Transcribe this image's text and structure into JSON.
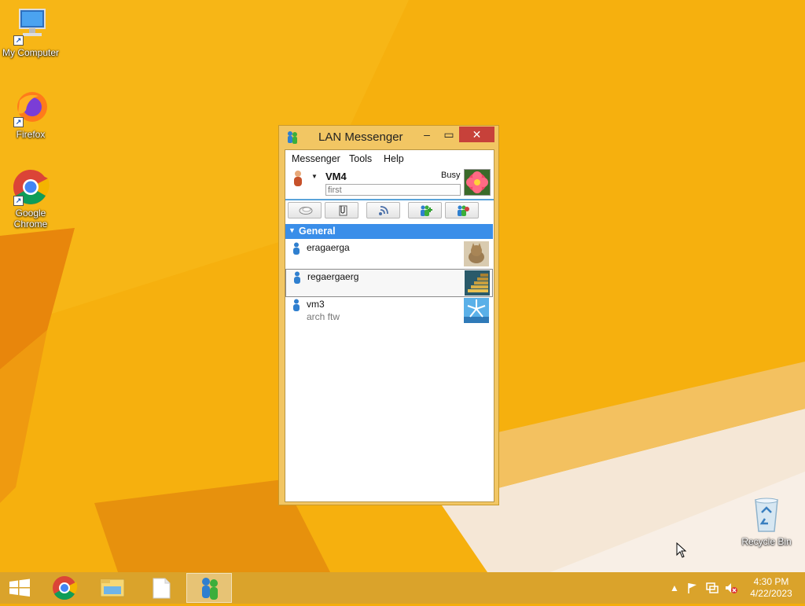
{
  "desktop": {
    "icons": [
      {
        "label": "My Computer",
        "icon": "computer-icon"
      },
      {
        "label": "Firefox",
        "icon": "firefox-icon"
      },
      {
        "label": "Google Chrome",
        "icon": "chrome-icon"
      },
      {
        "label": "Recycle Bin",
        "icon": "recycle-bin-icon"
      }
    ]
  },
  "window": {
    "title": "LAN Messenger",
    "controls": {
      "minimize": "‒",
      "maximize": "▭",
      "close": "✕"
    },
    "menu": [
      "Messenger",
      "Tools",
      "Help"
    ],
    "profile": {
      "name": "VM4",
      "status": "Busy",
      "note": "first",
      "status_icon": "busy-person-icon",
      "avatar": "flower-avatar"
    },
    "toolbar": [
      "chat-icon",
      "file-transfer-icon",
      "broadcast-icon",
      "add-contacts-icon",
      "settings-icon"
    ],
    "group": {
      "name": "General",
      "expanded": true
    },
    "contacts": [
      {
        "name": "eragaerga",
        "note": "",
        "avatar": "cat-avatar",
        "status_icon": "online-person-icon"
      },
      {
        "name": "regaergaerg",
        "note": "",
        "avatar": "stairs-avatar",
        "status_icon": "online-person-icon",
        "selected": true
      },
      {
        "name": "vm3",
        "note": "arch ftw",
        "avatar": "windmill-avatar",
        "status_icon": "online-person-icon"
      }
    ]
  },
  "taskbar": {
    "items": [
      "start-icon",
      "chrome-icon",
      "file-explorer-icon",
      "notepad-icon",
      "lan-messenger-icon"
    ],
    "active_item": "lan-messenger-icon",
    "time": "4:30 PM",
    "date": "4/22/2023"
  },
  "colors": {
    "wallpaper": "#f4ad0c",
    "group_header": "#3a8ee9",
    "close_button": "#c7413a",
    "window_frame": "#f2c663"
  }
}
